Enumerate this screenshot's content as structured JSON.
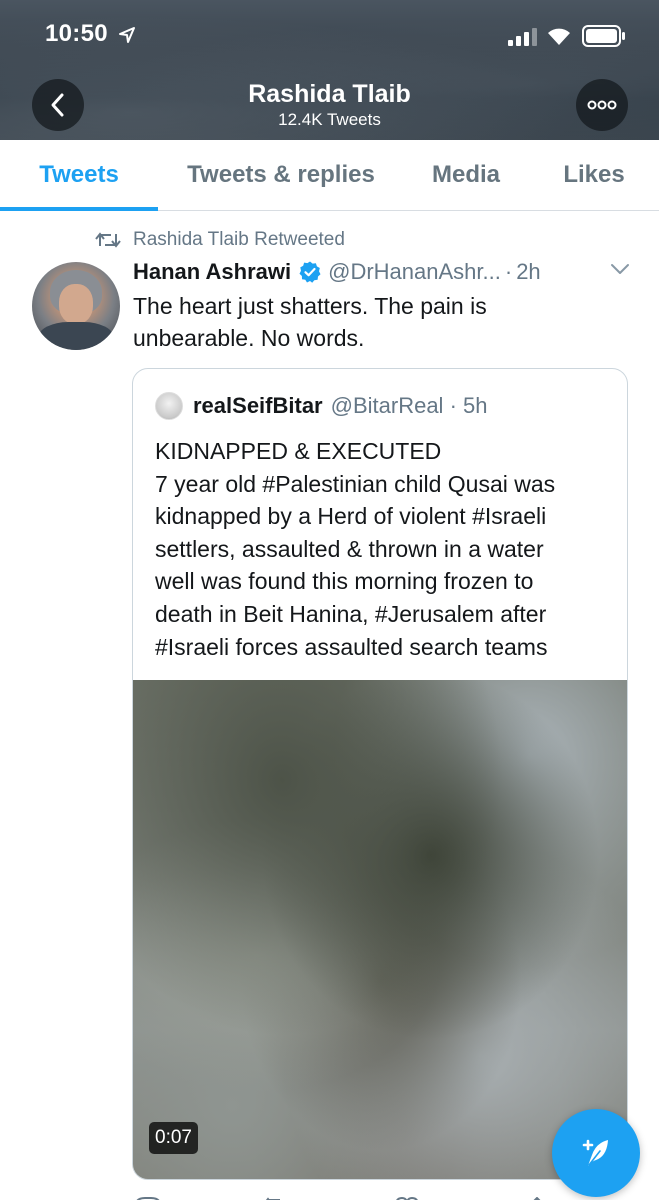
{
  "status_bar": {
    "time": "10:50"
  },
  "header": {
    "title": "Rashida Tlaib",
    "subtitle": "12.4K Tweets"
  },
  "tabs": [
    {
      "label": "Tweets",
      "active": true
    },
    {
      "label": "Tweets & replies",
      "active": false
    },
    {
      "label": "Media",
      "active": false
    },
    {
      "label": "Likes",
      "active": false
    }
  ],
  "tweet": {
    "retweet_label": "Rashida Tlaib Retweeted",
    "author_name": "Hanan Ashrawi",
    "author_handle": "@DrHananAshr...",
    "time": "2h",
    "text_lines": [
      "The heart just shatters. The pain is",
      "unbearable. No words."
    ],
    "quote": {
      "author_name": "realSeifBitar",
      "author_handle": "@BitarReal",
      "time": "5h",
      "text_lines": [
        "KIDNAPPED & EXECUTED",
        "7 year old #Palestinian child Qusai was",
        "kidnapped by a Herd of violent #Israeli",
        "settlers, assaulted & thrown in a water",
        "well was found this morning frozen to",
        "death in Beit Hanina, #Jerusalem after",
        "#Israeli forces assaulted search teams"
      ],
      "video_duration": "0:07"
    }
  },
  "colors": {
    "accent": "#1da1f2",
    "secondary_text": "#657786",
    "primary_text": "#14171a"
  },
  "icons": {
    "back": "chevron-left-icon",
    "more": "more-horizontal-icon",
    "retweet": "retweet-icon",
    "verified": "verified-badge-icon",
    "caret": "chevron-down-icon",
    "compose": "compose-tweet-icon"
  }
}
